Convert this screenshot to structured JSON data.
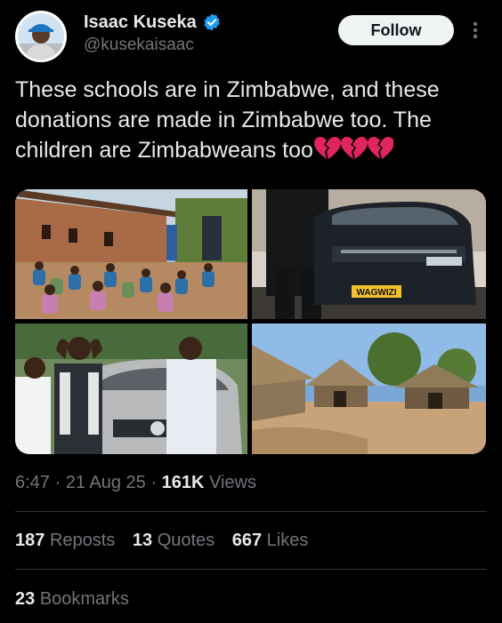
{
  "author": {
    "display_name": "Isaac Kuseka",
    "handle": "@kusekaisaac",
    "verified_color": "#1d9bf0"
  },
  "header": {
    "follow_label": "Follow",
    "more_icon": "more-vertical-icon"
  },
  "tweet": {
    "text": "These schools are in Zimbabwe, and these donations are made in Zimbabwe too. The children are Zimbabweans too",
    "emoji": "broken-heart x3",
    "media": [
      {
        "kind": "photo",
        "subject": "outdoor-classroom"
      },
      {
        "kind": "photo",
        "subject": "car-with-plate",
        "plate_text": "WAGWIZI"
      },
      {
        "kind": "photo",
        "subject": "people-by-car"
      },
      {
        "kind": "photo",
        "subject": "thatched-huts"
      }
    ]
  },
  "meta": {
    "time": "6:47",
    "sep1": " · ",
    "date": "21 Aug 25",
    "sep2": " · ",
    "views_count": "161K",
    "views_label": "Views"
  },
  "stats": {
    "reposts_count": "187",
    "reposts_label": "Reposts",
    "quotes_count": "13",
    "quotes_label": "Quotes",
    "likes_count": "667",
    "likes_label": "Likes"
  },
  "bookmarks": {
    "count": "23",
    "label": "Bookmarks"
  },
  "colors": {
    "background": "#000000",
    "text_primary": "#e7e9ea",
    "text_secondary": "#71767b",
    "divider": "#2f3336",
    "follow_bg": "#eff3f4",
    "heart": "#e0245e"
  }
}
